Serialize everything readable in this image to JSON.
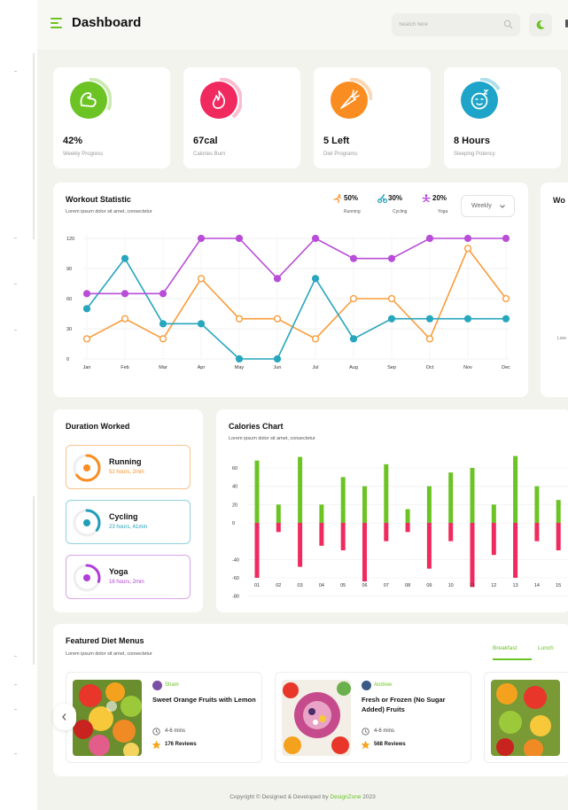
{
  "header": {
    "title": "Dashboard",
    "search_placeholder": "Search here"
  },
  "stats": [
    {
      "value": "42%",
      "label": "Weekly Progress",
      "color": "#6cc324",
      "icon": "arm-muscle-icon"
    },
    {
      "value": "67cal",
      "label": "Calories Burn",
      "color": "#f0295e",
      "icon": "flame-icon"
    },
    {
      "value": "5 Left",
      "label": "Diet Programs",
      "color": "#fa8d22",
      "icon": "carrot-icon"
    },
    {
      "value": "8 Hours",
      "label": "Sleeping Potency",
      "color": "#1ea4c8",
      "icon": "sleep-face-icon"
    }
  ],
  "workout": {
    "title": "Workout Statistic",
    "subtitle": "Lorem ipsum dolor sit amet, consectetur",
    "legend": [
      {
        "pct": "50%",
        "name": "Running",
        "color": "#fa8d22"
      },
      {
        "pct": "30%",
        "name": "Cycling",
        "color": "#1e9fb8"
      },
      {
        "pct": "20%",
        "name": "Yoga",
        "color": "#b03fd8"
      }
    ],
    "period": "Weekly",
    "side_title": "Wo",
    "side_sub": "Lore"
  },
  "chart_data": [
    {
      "type": "line",
      "categories": [
        "Jan",
        "Feb",
        "Mar",
        "Apr",
        "May",
        "Jun",
        "Jul",
        "Aug",
        "Sep",
        "Oct",
        "Nov",
        "Dec"
      ],
      "yticks": [
        0,
        30,
        60,
        90,
        120
      ],
      "ylim": [
        0,
        120
      ],
      "grid": true,
      "series": [
        {
          "name": "Running",
          "color": "#fa9c3c",
          "values": [
            20,
            40,
            20,
            80,
            40,
            40,
            20,
            60,
            60,
            20,
            110,
            60
          ]
        },
        {
          "name": "Cycling",
          "color": "#27a6bd",
          "values": [
            50,
            100,
            35,
            35,
            0,
            0,
            80,
            20,
            40,
            40,
            40,
            40
          ]
        },
        {
          "name": "Yoga",
          "color": "#b84ed8",
          "values": [
            65,
            65,
            65,
            120,
            120,
            80,
            120,
            100,
            100,
            120,
            120,
            120
          ]
        }
      ]
    },
    {
      "type": "bar",
      "title": "Calories Chart",
      "categories": [
        "01",
        "02",
        "03",
        "04",
        "05",
        "06",
        "07",
        "08",
        "09",
        "10",
        "11",
        "12",
        "13",
        "14",
        "15"
      ],
      "yticks": [
        60,
        40,
        20,
        0,
        -40,
        -60,
        -80
      ],
      "ylim": [
        -80,
        70
      ],
      "series": [
        {
          "name": "positive",
          "color": "#6cc324",
          "values": [
            68,
            20,
            72,
            20,
            50,
            40,
            64,
            15,
            40,
            55,
            60,
            20,
            73,
            40,
            25
          ]
        },
        {
          "name": "negative",
          "color": "#f0295e",
          "values": [
            -60,
            -10,
            -48,
            -25,
            -30,
            -64,
            -20,
            -10,
            -50,
            -20,
            -70,
            -35,
            -60,
            -20,
            -30
          ]
        }
      ]
    }
  ],
  "duration": {
    "title": "Duration Worked",
    "items": [
      {
        "name": "Running",
        "sub": "52 hours, 2min",
        "color": "#fa8d22",
        "border": "#f9c48d",
        "icon": "running-icon",
        "progress": 0.65
      },
      {
        "name": "Cycling",
        "sub": "23 hours, 41min",
        "color": "#1e9fb8",
        "border": "#8fd0de",
        "icon": "cycling-icon",
        "progress": 0.35
      },
      {
        "name": "Yoga",
        "sub": "16 hours, 2min",
        "color": "#b03fd8",
        "border": "#d9a5ea",
        "icon": "yoga-icon",
        "progress": 0.3
      }
    ]
  },
  "calories": {
    "title": "Calories Chart",
    "subtitle": "Lorem ipsum dolor sit amet, consectetur"
  },
  "diet": {
    "title": "Featured Diet Menus",
    "subtitle": "Lorem ipsum dolor sit amet, consectetur",
    "tabs": [
      "Breakfast",
      "Lunch"
    ],
    "menus": [
      {
        "author": "Sham",
        "dish": "Sweet Orange Fruits with Lemon",
        "time": "4-6 mins",
        "reviews": "176 Reviews"
      },
      {
        "author": "Andrew",
        "dish": "Fresh or Frozen (No Sugar Added) Fruits",
        "time": "4-6 mins",
        "reviews": "568 Reviews"
      }
    ]
  },
  "footer": {
    "text": "Copyright © Designed & Developed by",
    "brand": "DesignZone",
    "year": "2023"
  }
}
